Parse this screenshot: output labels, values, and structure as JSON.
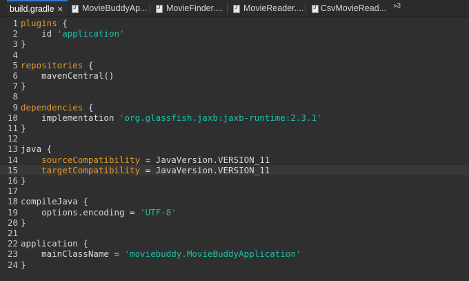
{
  "tabs": [
    {
      "label": "build.gradle",
      "active": true,
      "close": "✕"
    },
    {
      "label": "MovieBuddyAp...",
      "icon": "java-file-icon"
    },
    {
      "label": "MovieFinder....",
      "icon": "java-file-icon"
    },
    {
      "label": "MovieReader....",
      "icon": "java-file-icon"
    },
    {
      "label": "CsvMovieRead...",
      "icon": "java-file-icon"
    }
  ],
  "overflow": "»3",
  "editor": {
    "current_line": 15,
    "lines": [
      {
        "n": "1",
        "kw": "plugins",
        "rest": " {"
      },
      {
        "n": "2",
        "pre": "    id ",
        "str": "'application'"
      },
      {
        "n": "3",
        "plain": "}"
      },
      {
        "n": "4",
        "plain": ""
      },
      {
        "n": "5",
        "kw": "repositories",
        "rest": " {"
      },
      {
        "n": "6",
        "plain": "    mavenCentral()"
      },
      {
        "n": "7",
        "plain": "}"
      },
      {
        "n": "8",
        "plain": ""
      },
      {
        "n": "9",
        "kw": "dependencies",
        "rest": " {"
      },
      {
        "n": "10",
        "pre": "    implementation ",
        "str": "'org.glassfish.jaxb:jaxb-runtime:2.3.1'"
      },
      {
        "n": "11",
        "plain": "}"
      },
      {
        "n": "12",
        "plain": ""
      },
      {
        "n": "13",
        "plain": "java {"
      },
      {
        "n": "14",
        "pre": "    ",
        "kw": "sourceCompatibility",
        "rest": " = JavaVersion.VERSION_11"
      },
      {
        "n": "15",
        "pre": "    ",
        "kw": "targetCompatibility",
        "rest": " = JavaVersion.VERSION_11"
      },
      {
        "n": "16",
        "plain": "}"
      },
      {
        "n": "17",
        "plain": ""
      },
      {
        "n": "18",
        "plain": "compileJava {"
      },
      {
        "n": "19",
        "pre": "    options.encoding = ",
        "str": "'UTF-8'"
      },
      {
        "n": "20",
        "plain": "}"
      },
      {
        "n": "21",
        "plain": ""
      },
      {
        "n": "22",
        "plain": "application {"
      },
      {
        "n": "23",
        "pre": "    mainClassName = ",
        "str": "'moviebuddy.MovieBuddyApplication'"
      },
      {
        "n": "24",
        "plain": "}"
      }
    ]
  },
  "colors": {
    "background": "#2f2f2f",
    "keyword": "#e39a2f",
    "string": "#19c3a6",
    "text": "#d9d9d9",
    "active_tab_accent": "#2e7bd6"
  }
}
